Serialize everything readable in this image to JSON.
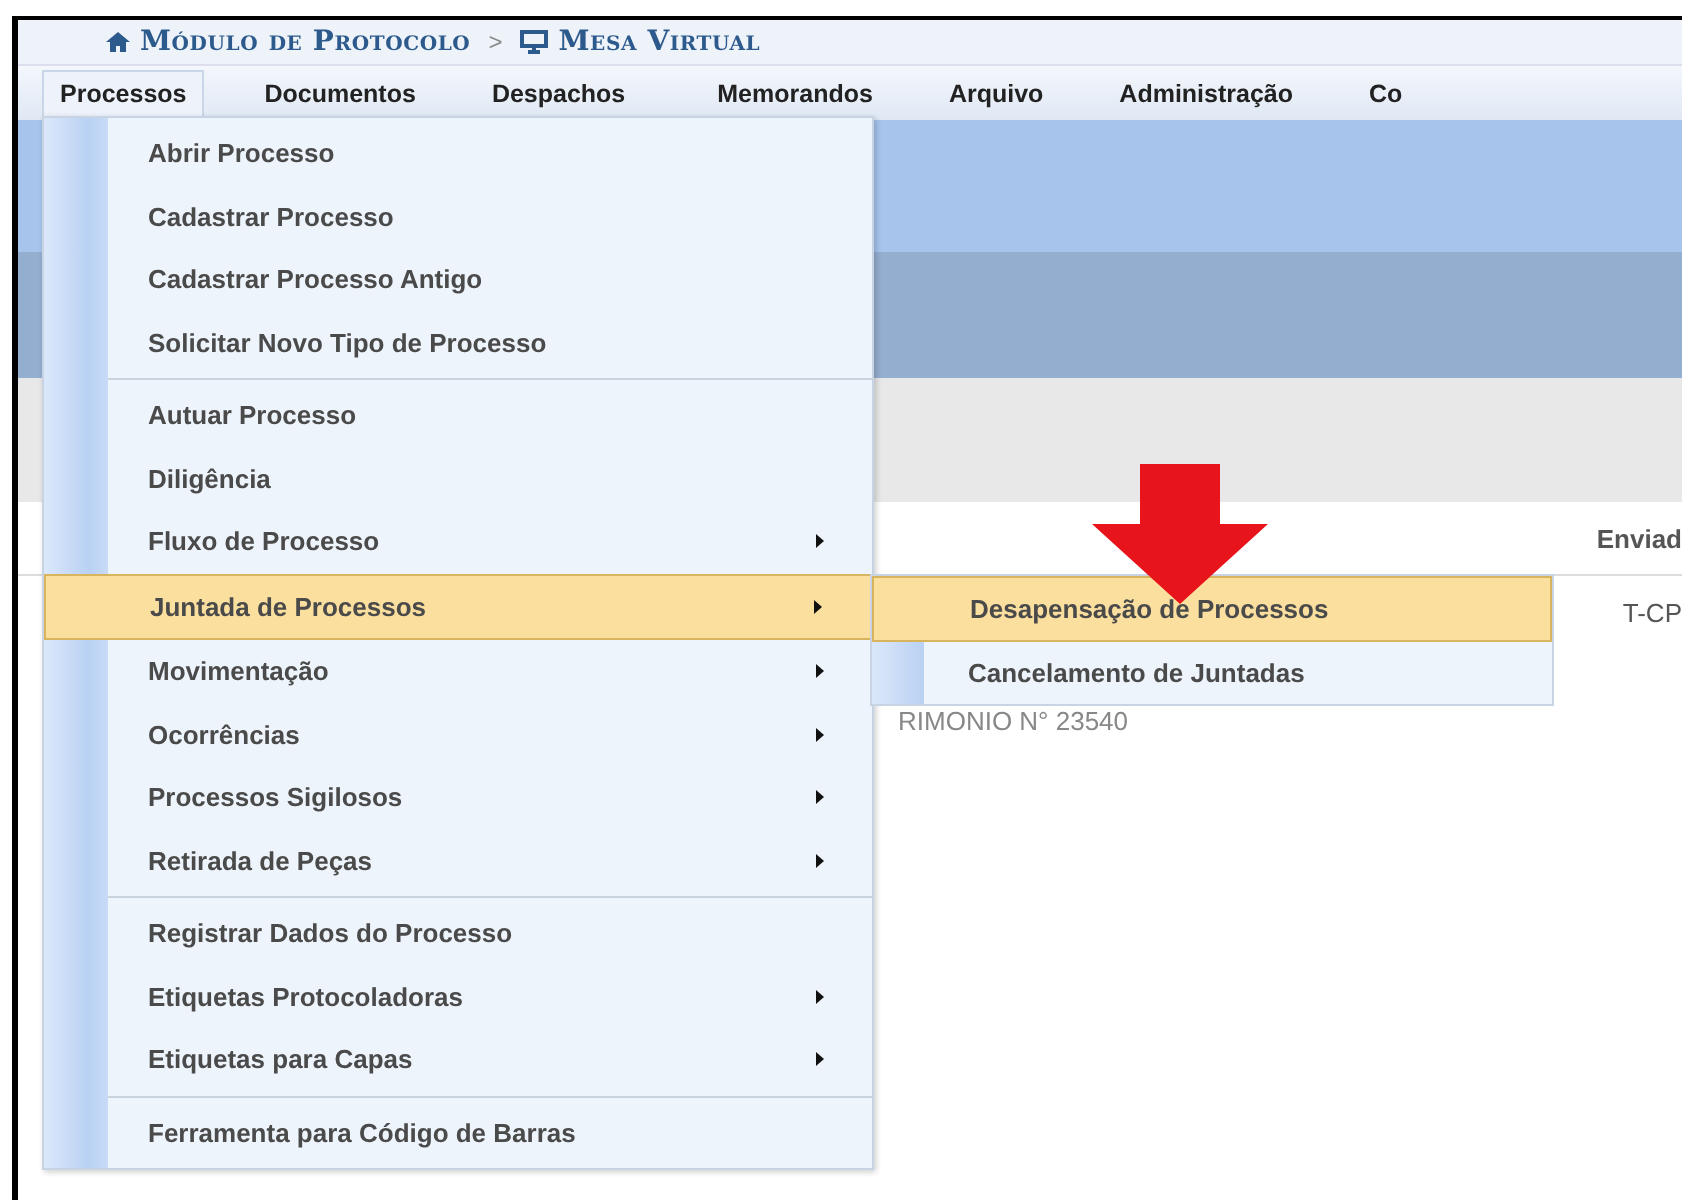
{
  "breadcrumb": {
    "module": "Módulo de Protocolo",
    "separator": ">",
    "page": "Mesa Virtual"
  },
  "menubar": [
    {
      "label": "Processos",
      "selected": true
    },
    {
      "label": "Documentos",
      "selected": false
    },
    {
      "label": "Despachos",
      "selected": false
    },
    {
      "label": "Memorandos",
      "selected": false
    },
    {
      "label": "Arquivo",
      "selected": false
    },
    {
      "label": "Administração",
      "selected": false
    },
    {
      "label": "Co",
      "selected": false
    }
  ],
  "background": {
    "column_header": "Enviad",
    "row_text": "T-CP",
    "row_text_2": "RIMONIO N° 23540"
  },
  "dropdown": {
    "groups": [
      {
        "items": [
          {
            "label": "Abrir Processo",
            "submenu": false,
            "selected": false
          },
          {
            "label": "Cadastrar Processo",
            "submenu": false,
            "selected": false
          },
          {
            "label": "Cadastrar Processo Antigo",
            "submenu": false,
            "selected": false
          },
          {
            "label": "Solicitar Novo Tipo de Processo",
            "submenu": false,
            "selected": false
          }
        ]
      },
      {
        "items": [
          {
            "label": "Autuar Processo",
            "submenu": false,
            "selected": false
          },
          {
            "label": "Diligência",
            "submenu": false,
            "selected": false
          },
          {
            "label": "Fluxo de Processo",
            "submenu": true,
            "selected": false
          },
          {
            "label": "Juntada de Processos",
            "submenu": true,
            "selected": true
          },
          {
            "label": "Movimentação",
            "submenu": true,
            "selected": false
          },
          {
            "label": "Ocorrências",
            "submenu": true,
            "selected": false
          },
          {
            "label": "Processos Sigilosos",
            "submenu": true,
            "selected": false
          },
          {
            "label": "Retirada de Peças",
            "submenu": true,
            "selected": false
          }
        ]
      },
      {
        "items": [
          {
            "label": "Registrar Dados do Processo",
            "submenu": false,
            "selected": false
          },
          {
            "label": "Etiquetas Protocoladoras",
            "submenu": true,
            "selected": false
          },
          {
            "label": "Etiquetas para Capas",
            "submenu": true,
            "selected": false
          }
        ]
      },
      {
        "items": [
          {
            "label": "Ferramenta para Código de Barras",
            "submenu": false,
            "selected": false
          }
        ]
      }
    ]
  },
  "submenu": {
    "items": [
      {
        "label": "Desapensação de Processos",
        "selected": true
      },
      {
        "label": "Cancelamento de Juntadas",
        "selected": false
      }
    ]
  }
}
